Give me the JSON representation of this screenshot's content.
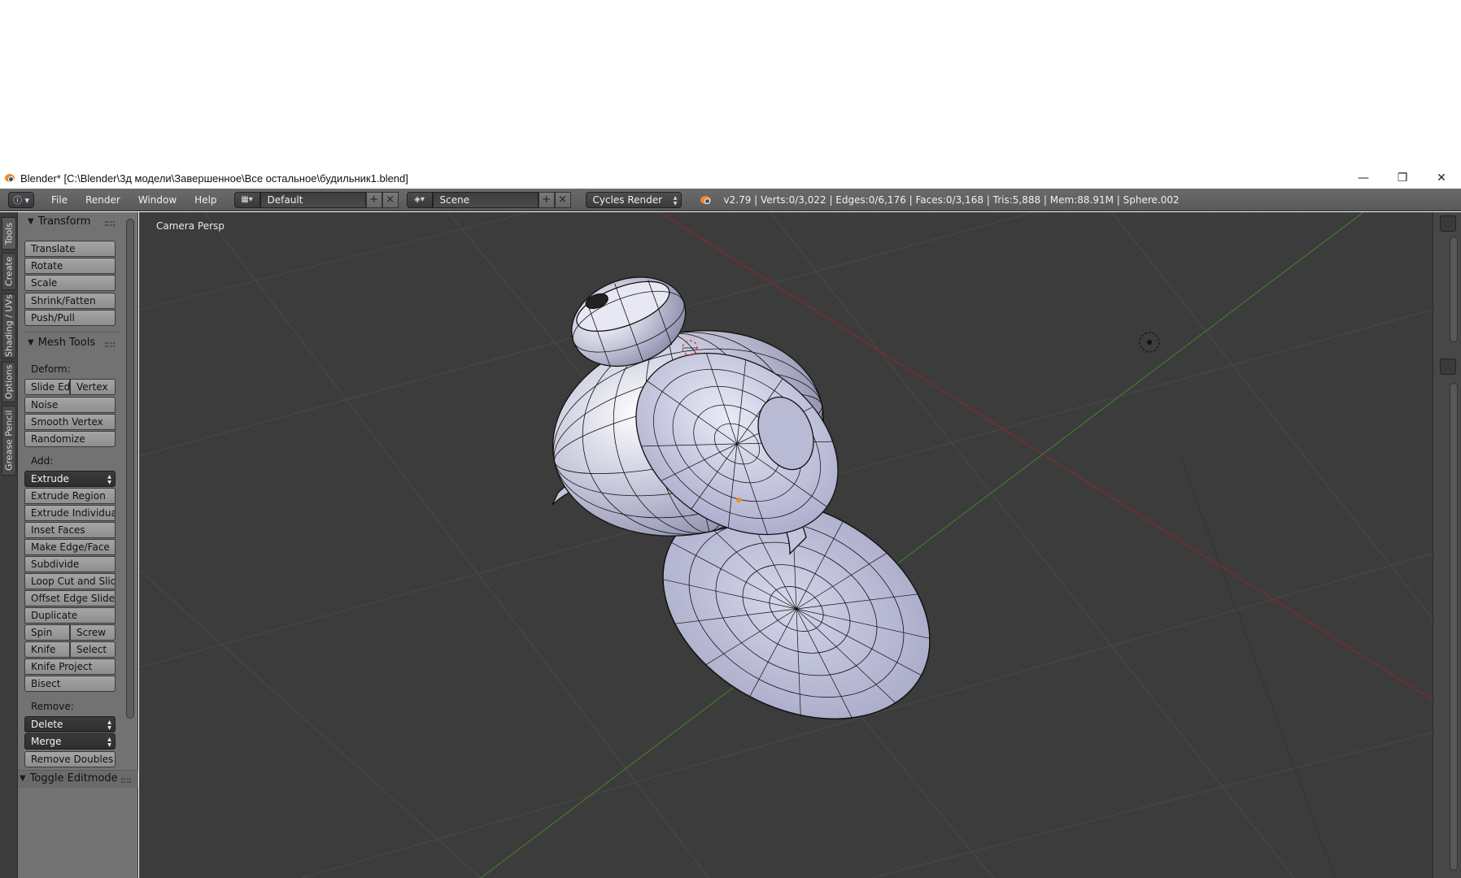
{
  "window": {
    "title": "Blender* [C:\\Blender\\3д модели\\Завершенное\\Все остальное\\будильник1.blend]",
    "minimize": "—",
    "restore": "❐",
    "close": "✕"
  },
  "header": {
    "menus": [
      "File",
      "Render",
      "Window",
      "Help"
    ],
    "layout": "Default",
    "scene": "Scene",
    "engine": "Cycles Render",
    "stats": "v2.79 | Verts:0/3,022 | Edges:0/6,176 | Faces:0/3,168 | Tris:5,888 | Mem:88.91M | Sphere.002"
  },
  "shelf_tabs": [
    "Tools",
    "Create",
    "Shading / UVs",
    "Options",
    "Grease Pencil"
  ],
  "tools": {
    "transform_title": "Transform",
    "transform": [
      "Translate",
      "Rotate",
      "Scale",
      "Shrink/Fatten",
      "Push/Pull"
    ],
    "mesh_tools_title": "Mesh Tools",
    "deform_label": "Deform:",
    "slide_edge": "Slide Ed",
    "vertex": "Vertex",
    "noise": "Noise",
    "smooth_vertex": "Smooth Vertex",
    "randomize": "Randomize",
    "add_label": "Add:",
    "extrude": "Extrude",
    "add_items": [
      "Extrude Region",
      "Extrude Individual",
      "Inset Faces",
      "Make Edge/Face",
      "Subdivide",
      "Loop Cut and Slide",
      "Offset Edge Slide",
      "Duplicate"
    ],
    "spin": "Spin",
    "screw": "Screw",
    "knife": "Knife",
    "select": "Select",
    "knife_project": "Knife Project",
    "bisect": "Bisect",
    "remove_label": "Remove:",
    "delete": "Delete",
    "merge": "Merge",
    "remove_doubles": "Remove Doubles",
    "toggle_editmode": "Toggle Editmode"
  },
  "viewport": {
    "label": "Camera Persp"
  },
  "colors": {
    "viewport_bg": "#3c3c3c",
    "x_axis": "#8a2a2a",
    "y_axis": "#3f7a2e",
    "mesh_fill": "#c9cbe0",
    "wire": "#111111"
  }
}
